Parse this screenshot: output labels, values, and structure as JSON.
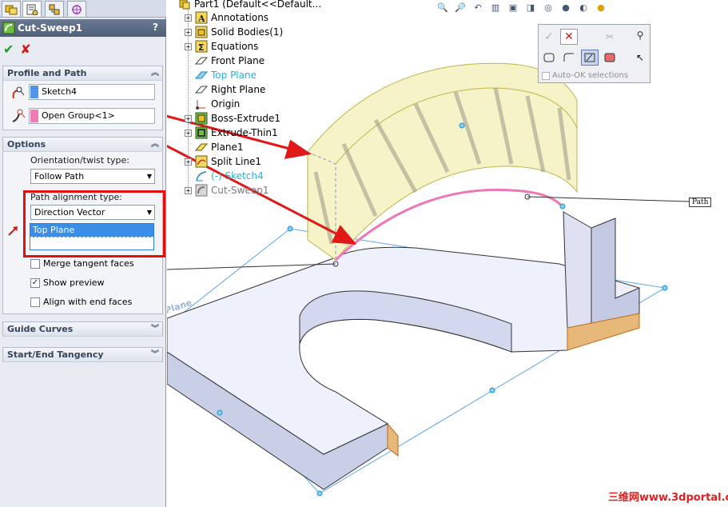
{
  "property_manager": {
    "title": "Cut-Sweep1",
    "help": "?",
    "ok_glyph": "✔",
    "cancel_glyph": "✘",
    "profile_path": {
      "header": "Profile and Path",
      "profile": "Sketch4",
      "path": "Open Group<1>",
      "profile_color": "#4f96e8",
      "path_color": "#f07ab3"
    },
    "options": {
      "header": "Options",
      "orientation_label": "Orientation/twist type:",
      "orientation_value": "Follow Path",
      "alignment_label": "Path alignment type:",
      "alignment_value": "Direction Vector",
      "direction_selection": "Top Plane",
      "merge_tangent": "Merge tangent faces",
      "merge_tangent_checked": false,
      "show_preview": "Show preview",
      "show_preview_checked": true,
      "align_end": "Align with end faces",
      "align_end_checked": false
    },
    "guide_curves": "Guide Curves",
    "start_end_tangency": "Start/End Tangency"
  },
  "feature_tree": {
    "root": "Part1  (Default<<Default...",
    "items": [
      {
        "label": "Annotations",
        "expand": true,
        "icon": "annotations-icon",
        "color": "#000"
      },
      {
        "label": "Solid Bodies(1)",
        "expand": true,
        "icon": "solid-bodies-icon",
        "color": "#000"
      },
      {
        "label": "Equations",
        "expand": true,
        "icon": "equations-icon",
        "color": "#000"
      },
      {
        "label": "Front Plane",
        "expand": false,
        "icon": "plane-icon",
        "color": "#000"
      },
      {
        "label": "Top Plane",
        "expand": false,
        "icon": "plane-selected-icon",
        "color": "#18b6e6"
      },
      {
        "label": "Right Plane",
        "expand": false,
        "icon": "plane-icon",
        "color": "#000"
      },
      {
        "label": "Origin",
        "expand": false,
        "icon": "origin-icon",
        "color": "#000"
      },
      {
        "label": "Boss-Extrude1",
        "expand": true,
        "icon": "boss-extrude-icon",
        "color": "#000"
      },
      {
        "label": "Extrude-Thin1",
        "expand": true,
        "icon": "extrude-thin-icon",
        "color": "#000"
      },
      {
        "label": "Plane1",
        "expand": false,
        "icon": "plane-yellow-icon",
        "color": "#000"
      },
      {
        "label": "Split Line1",
        "expand": true,
        "icon": "split-line-icon",
        "color": "#000"
      },
      {
        "label": "(-) Sketch4",
        "expand": false,
        "icon": "sketch-icon",
        "color": "#18b6e6"
      },
      {
        "label": "Cut-Sweep1",
        "expand": true,
        "icon": "cut-sweep-icon",
        "color": "#7a7a7a"
      }
    ]
  },
  "confirmation_corner": {
    "auto_ok": "Auto-OK selections"
  },
  "viewport": {
    "path_label": "Path",
    "plane_label": "Plane"
  },
  "watermark": "三维网www.3dportal.cn"
}
